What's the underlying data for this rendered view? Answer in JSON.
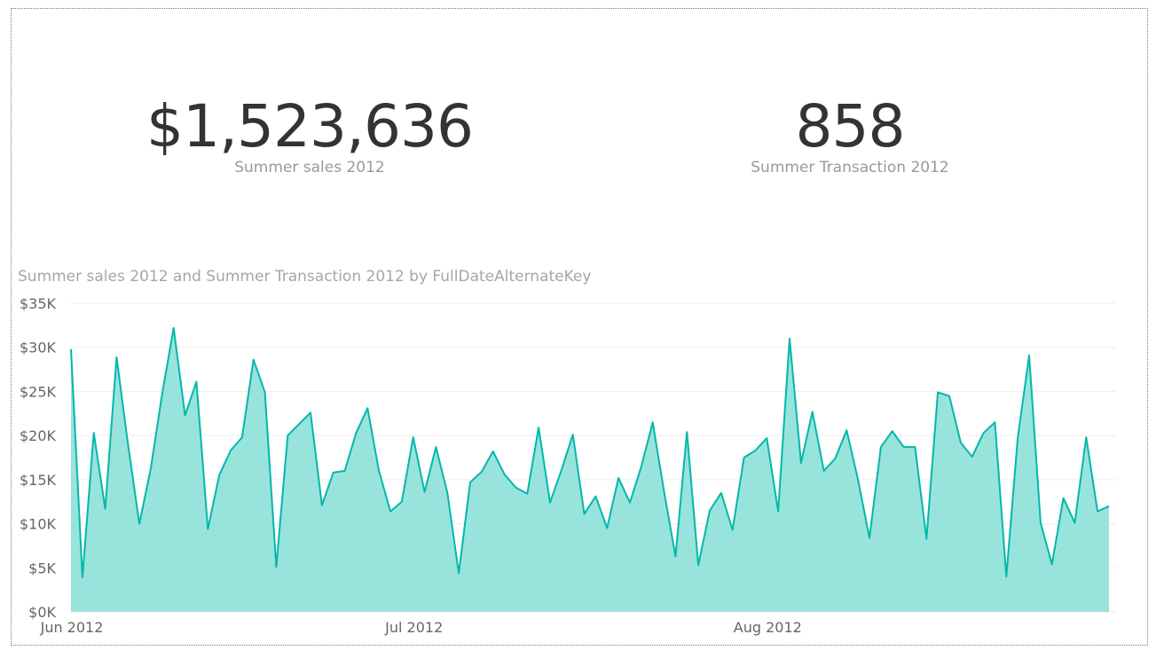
{
  "kpis": {
    "sales": {
      "value": "$1,523,636",
      "label": "Summer sales 2012"
    },
    "transactions": {
      "value": "858",
      "label": "Summer Transaction 2012"
    }
  },
  "colors": {
    "line": "#01b8aa",
    "area": "#99e3dd",
    "grid": "#eeeeee",
    "text": "#333333",
    "muted": "#999999"
  },
  "chart_data": {
    "type": "area",
    "title": "Summer sales 2012 and Summer Transaction 2012 by FullDateAlternateKey",
    "xlabel": "",
    "ylabel": "",
    "ylim": [
      0,
      35000
    ],
    "y_ticks": [
      {
        "value": 0,
        "label": "$0K"
      },
      {
        "value": 5000,
        "label": "$5K"
      },
      {
        "value": 10000,
        "label": "$10K"
      },
      {
        "value": 15000,
        "label": "$15K"
      },
      {
        "value": 20000,
        "label": "$20K"
      },
      {
        "value": 25000,
        "label": "$25K"
      },
      {
        "value": 30000,
        "label": "$30K"
      },
      {
        "value": 35000,
        "label": "$35K"
      }
    ],
    "x_ticks": [
      {
        "date": "2012-06-01",
        "label": "Jun 2012"
      },
      {
        "date": "2012-07-01",
        "label": "Jul 2012"
      },
      {
        "date": "2012-08-01",
        "label": "Aug 2012"
      }
    ],
    "grid": true,
    "legend": "none",
    "x": [
      "2012-06-01",
      "2012-06-02",
      "2012-06-03",
      "2012-06-04",
      "2012-06-05",
      "2012-06-06",
      "2012-06-07",
      "2012-06-08",
      "2012-06-09",
      "2012-06-10",
      "2012-06-11",
      "2012-06-12",
      "2012-06-13",
      "2012-06-14",
      "2012-06-15",
      "2012-06-16",
      "2012-06-17",
      "2012-06-18",
      "2012-06-19",
      "2012-06-20",
      "2012-06-21",
      "2012-06-22",
      "2012-06-23",
      "2012-06-24",
      "2012-06-25",
      "2012-06-26",
      "2012-06-27",
      "2012-06-28",
      "2012-06-29",
      "2012-06-30",
      "2012-07-01",
      "2012-07-02",
      "2012-07-03",
      "2012-07-04",
      "2012-07-05",
      "2012-07-06",
      "2012-07-07",
      "2012-07-08",
      "2012-07-09",
      "2012-07-10",
      "2012-07-11",
      "2012-07-12",
      "2012-07-13",
      "2012-07-14",
      "2012-07-15",
      "2012-07-16",
      "2012-07-17",
      "2012-07-18",
      "2012-07-19",
      "2012-07-20",
      "2012-07-21",
      "2012-07-22",
      "2012-07-23",
      "2012-07-24",
      "2012-07-25",
      "2012-07-26",
      "2012-07-27",
      "2012-07-28",
      "2012-07-29",
      "2012-07-30",
      "2012-07-31",
      "2012-08-01",
      "2012-08-02",
      "2012-08-03",
      "2012-08-04",
      "2012-08-05",
      "2012-08-06",
      "2012-08-07",
      "2012-08-08",
      "2012-08-09",
      "2012-08-10",
      "2012-08-11",
      "2012-08-12",
      "2012-08-13",
      "2012-08-14",
      "2012-08-15",
      "2012-08-16",
      "2012-08-17",
      "2012-08-18",
      "2012-08-19",
      "2012-08-20",
      "2012-08-21",
      "2012-08-22",
      "2012-08-23",
      "2012-08-24",
      "2012-08-25",
      "2012-08-26",
      "2012-08-27",
      "2012-08-28",
      "2012-08-29",
      "2012-08-30",
      "2012-08-31"
    ],
    "series": [
      {
        "values": [
          29800,
          3900,
          20300,
          11700,
          28900,
          19000,
          10000,
          16300,
          24800,
          32200,
          22300,
          26100,
          9400,
          15500,
          18300,
          19800,
          28600,
          24900,
          5100,
          20000,
          21300,
          22600,
          12100,
          15800,
          16000,
          20300,
          23100,
          16000,
          11400,
          12500,
          19800,
          13600,
          18700,
          13500,
          4400,
          14700,
          15900,
          18200,
          15600,
          14100,
          13400,
          20900,
          12400,
          16100,
          20100,
          11100,
          13100,
          9500,
          15200,
          12400,
          16500,
          21500,
          13600,
          6300,
          20400,
          5300,
          11500,
          13500,
          9300,
          17500,
          18300,
          19700,
          11400,
          31000,
          16900,
          22700,
          16000,
          17400,
          20600,
          15000,
          8400,
          18700,
          20500,
          18700,
          18700,
          8300,
          24900,
          24500,
          19200,
          17600,
          20300,
          21500,
          4000,
          19700,
          29100,
          10100,
          5400,
          12900,
          10100,
          19800,
          11400,
          12000
        ]
      }
    ]
  }
}
